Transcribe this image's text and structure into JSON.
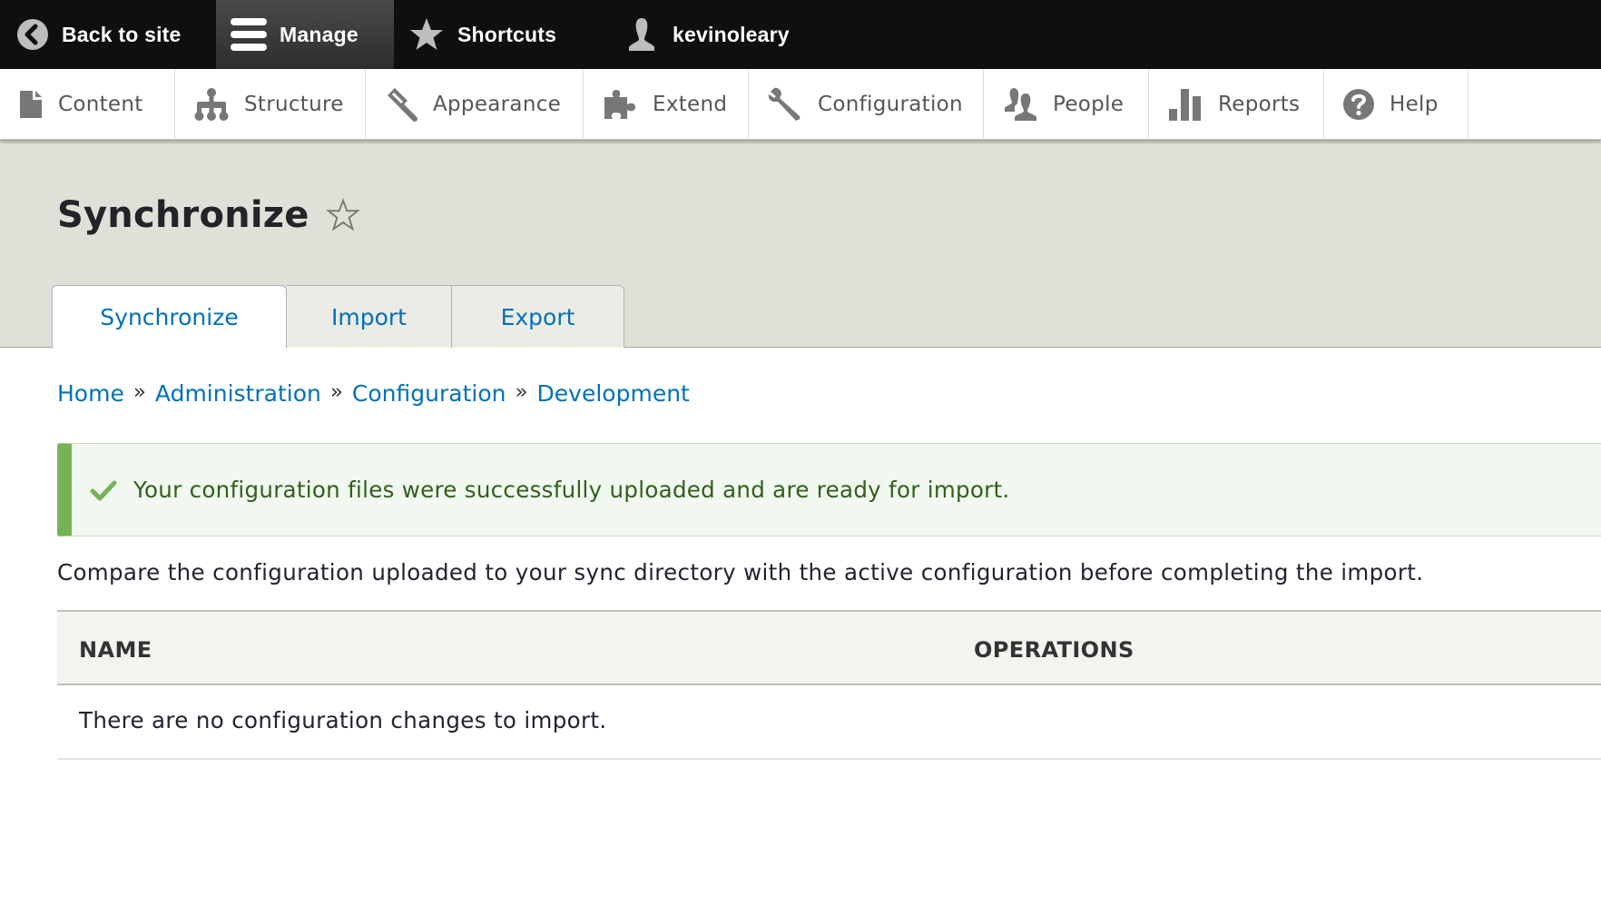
{
  "toolbar": {
    "back_label": "Back to site",
    "manage_label": "Manage",
    "shortcuts_label": "Shortcuts",
    "user_label": "kevinoleary"
  },
  "tray": {
    "items": [
      {
        "label": "Content",
        "icon": "file-icon"
      },
      {
        "label": "Structure",
        "icon": "sitemap-icon"
      },
      {
        "label": "Appearance",
        "icon": "paintbrush-icon"
      },
      {
        "label": "Extend",
        "icon": "puzzle-icon"
      },
      {
        "label": "Configuration",
        "icon": "wrench-icon"
      },
      {
        "label": "People",
        "icon": "people-icon"
      },
      {
        "label": "Reports",
        "icon": "bar-chart-icon"
      },
      {
        "label": "Help",
        "icon": "question-icon"
      }
    ]
  },
  "page": {
    "title": "Synchronize",
    "tabs": [
      {
        "label": "Synchronize",
        "active": true
      },
      {
        "label": "Import",
        "active": false
      },
      {
        "label": "Export",
        "active": false
      }
    ],
    "breadcrumb": [
      "Home",
      "Administration",
      "Configuration",
      "Development"
    ],
    "breadcrumb_separator": "»",
    "message": {
      "type": "status",
      "text": "Your configuration files were successfully uploaded and are ready for import."
    },
    "description": "Compare the configuration uploaded to your sync directory with the active configuration before completing the import.",
    "table": {
      "headers": [
        "NAME",
        "OPERATIONS"
      ],
      "empty_text": "There are no configuration changes to import."
    }
  },
  "colors": {
    "link": "#0071b8",
    "toolbar_bg": "#0f0f0f",
    "header_bg": "#e0e0d8",
    "status_border": "#77b259",
    "status_bg": "#f0f8ef",
    "status_text": "#325e1c"
  }
}
